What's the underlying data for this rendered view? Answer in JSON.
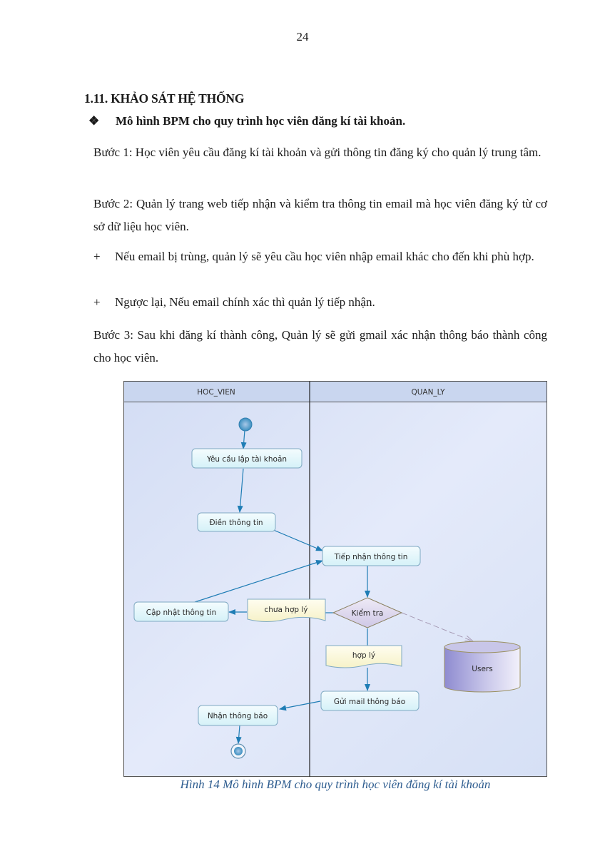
{
  "page": {
    "number": "24",
    "section_heading": "1.11. KHẢO SÁT HỆ THỐNG",
    "subheading_bullet": "❖",
    "subheading": "Mô hình BPM cho quy trình học viên đăng kí tài khoản.",
    "steps": [
      {
        "text": "Bước 1: Học viên yêu cầu đăng kí tài khoản và gửi thông tin đăng ký cho quản lý trung tâm."
      },
      {
        "text": "Bước 2: Quản lý trang web tiếp nhận và kiểm tra thông tin email mà học viên đăng ký từ cơ sở dữ liệu học viên."
      }
    ],
    "list_items": [
      {
        "sign": "+",
        "text": "Nếu email bị trùng, quản lý sẽ yêu cầu học viên nhập email khác cho đến khi phù hợp."
      },
      {
        "sign": "+",
        "text": "Ngược lại, Nếu email chính xác thì quản lý tiếp nhận."
      }
    ],
    "step3": "Bước 3: Sau khi đăng kí thành công, Quản lý sẽ gửi gmail xác nhận thông báo thành công cho học viên.",
    "caption": "Hình 14 Mô hình BPM cho quy trình học viên đăng kí tài khoản"
  },
  "diagram": {
    "lanes": [
      {
        "title": "HOC_VIEN"
      },
      {
        "title": "QUAN_LY"
      }
    ],
    "nodes": {
      "start": {
        "type": "start-event"
      },
      "yeu_cau": {
        "type": "task",
        "label": "Yêu cầu lập tài khoản",
        "lane": "HOC_VIEN"
      },
      "dien_thong_tin": {
        "type": "task",
        "label": "Điền thông tin",
        "lane": "HOC_VIEN"
      },
      "tiep_nhan": {
        "type": "task",
        "label": "Tiếp nhận thông tin",
        "lane": "QUAN_LY"
      },
      "kiem_tra": {
        "type": "gateway",
        "label": "Kiểm tra",
        "lane": "QUAN_LY"
      },
      "chua_hop_ly": {
        "type": "document",
        "label": "chưa hợp lý"
      },
      "cap_nhat": {
        "type": "task",
        "label": "Cập nhật thông tin",
        "lane": "HOC_VIEN"
      },
      "hop_ly": {
        "type": "document",
        "label": "hợp lý",
        "lane": "QUAN_LY"
      },
      "users": {
        "type": "database",
        "label": "Users",
        "lane": "QUAN_LY"
      },
      "gui_mail": {
        "type": "task",
        "label": "Gửi mail thông báo",
        "lane": "QUAN_LY"
      },
      "nhan_thong_bao": {
        "type": "task",
        "label": "Nhận thông báo",
        "lane": "HOC_VIEN"
      },
      "end": {
        "type": "end-event"
      }
    },
    "colors": {
      "lane_header": "#c9d6ef",
      "lane_bg": "#dde5f7",
      "task_fill": "#e3f6fb",
      "task_stroke": "#7fa9c2",
      "doc_fill": "#fbf8d8",
      "gateway_fill": "#dcd6ec",
      "gateway_stroke": "#8a8060",
      "db_fill": "#a9a6d9",
      "arrow": "#1f7db5",
      "caption": "#2d5c8f"
    }
  }
}
